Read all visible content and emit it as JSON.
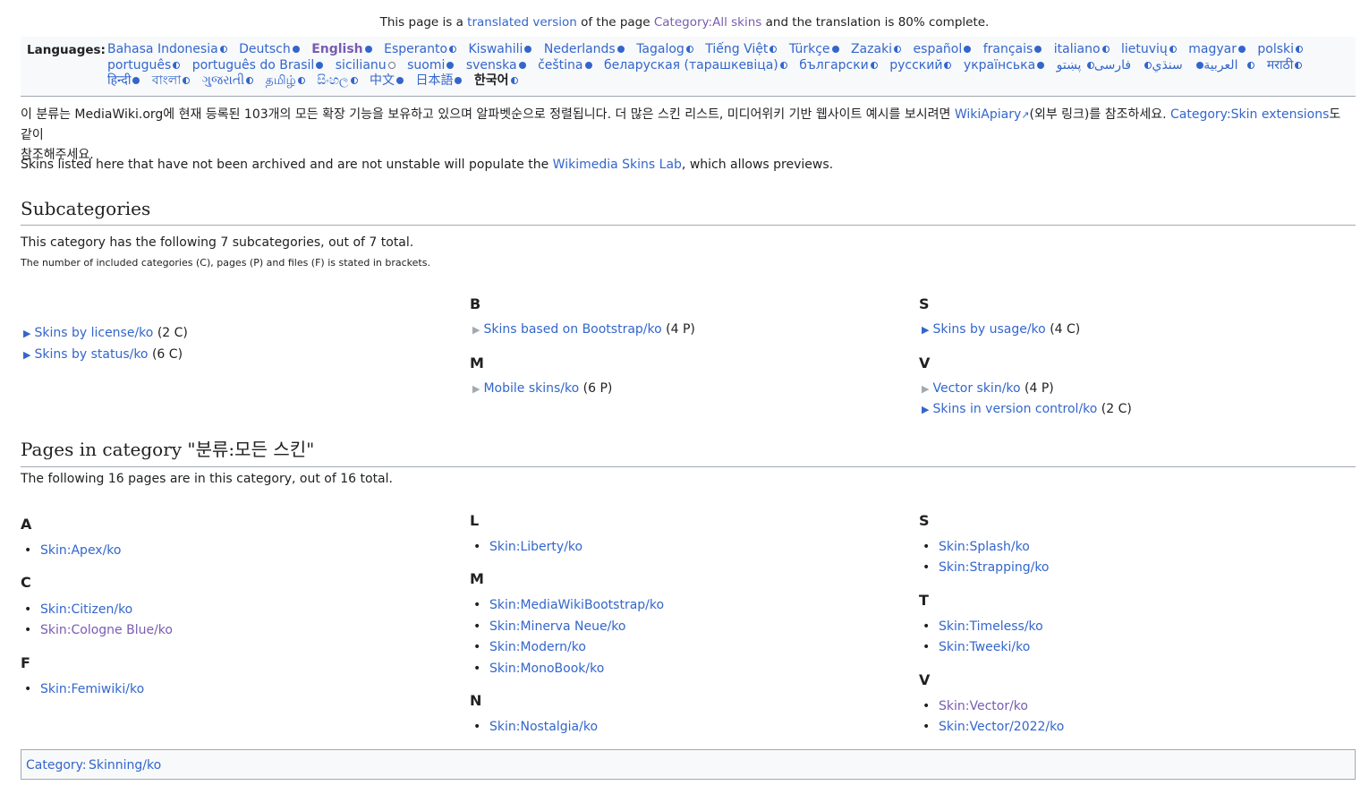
{
  "notice": {
    "prefix": "This page is a",
    "link1": "translated version",
    "middle": "of the page",
    "link2": "Category:All skins",
    "suffix": "and the translation is 80% complete."
  },
  "languages": {
    "label": "Languages:",
    "items": [
      {
        "name": "Bahasa Indonesia",
        "status": "part"
      },
      {
        "name": "Deutsch",
        "status": "full"
      },
      {
        "name": "English",
        "status": "full",
        "visited": true
      },
      {
        "name": "Esperanto",
        "status": "part"
      },
      {
        "name": "Kiswahili",
        "status": "full"
      },
      {
        "name": "Nederlands",
        "status": "full"
      },
      {
        "name": "Tagalog",
        "status": "part"
      },
      {
        "name": "Tiếng Việt",
        "status": "part"
      },
      {
        "name": "Türkçe",
        "status": "full"
      },
      {
        "name": "Zazaki",
        "status": "part"
      },
      {
        "name": "español",
        "status": "full"
      },
      {
        "name": "français",
        "status": "full"
      },
      {
        "name": "italiano",
        "status": "part"
      },
      {
        "name": "lietuvių",
        "status": "part"
      },
      {
        "name": "magyar",
        "status": "full"
      },
      {
        "name": "polski",
        "status": "part"
      },
      {
        "name": "português",
        "status": "part"
      },
      {
        "name": "português do Brasil",
        "status": "full"
      },
      {
        "name": "sicilianu",
        "status": "empty"
      },
      {
        "name": "suomi",
        "status": "full"
      },
      {
        "name": "svenska",
        "status": "full"
      },
      {
        "name": "čeština",
        "status": "full"
      },
      {
        "name": "беларуская (тарашкевіца)",
        "status": "part"
      },
      {
        "name": "български",
        "status": "part"
      },
      {
        "name": "русский",
        "status": "part"
      },
      {
        "name": "українська",
        "status": "full"
      },
      {
        "name": "العربية",
        "status": "full"
      },
      {
        "name": "سنڌي",
        "status": "part"
      },
      {
        "name": "فارسی",
        "status": "part"
      },
      {
        "name": "پښتو",
        "status": "part"
      },
      {
        "name": "मराठी",
        "status": "part"
      },
      {
        "name": "हिन्दी",
        "status": "full"
      },
      {
        "name": "বাংলা",
        "status": "part"
      },
      {
        "name": "ગુજરાતી",
        "status": "part"
      },
      {
        "name": "தமிழ்",
        "status": "part"
      },
      {
        "name": "සිංහල",
        "status": "part"
      },
      {
        "name": "中文",
        "status": "full"
      },
      {
        "name": "日本語",
        "status": "full"
      },
      {
        "name": "한국어",
        "status": "part",
        "current": true
      }
    ]
  },
  "intro": {
    "t1": "이 분류는 MediaWiki.org에 현재 등록된 103개의 모든 확장 기능을 보유하고 있으며 알파벳순으로 정렬됩니다. 더 많은 스킨 리스트, 미디어위키 기반 웹사이트 예시를 보시려면 ",
    "link1": "WikiApiary",
    "t2": "(외부 링크)를 참조하세요. ",
    "link2": "Category:Skin extensions",
    "t3": "도 같이",
    "t4": "참조해주세요.",
    "p2a": "Skins listed here that have not been archived and are not unstable will populate the ",
    "p2link": "Wikimedia Skins Lab",
    "p2b": ", which allows previews."
  },
  "subcats": {
    "heading": "Subcategories",
    "summary": "This category has the following 7 subcategories, out of 7 total.",
    "note": "The number of included categories (C), pages (P) and files (F) is stated in brackets.",
    "col1": [
      {
        "name": "Skins by license/ko",
        "count": "(2 C)"
      },
      {
        "name": "Skins by status/ko",
        "count": "(6 C)"
      }
    ],
    "col2": {
      "h_b": "B",
      "b": [
        {
          "name": "Skins based on Bootstrap/ko",
          "count": "(4 P)"
        }
      ],
      "h_m": "M",
      "m": [
        {
          "name": "Mobile skins/ko",
          "count": "(6 P)"
        }
      ]
    },
    "col3": {
      "h_s": "S",
      "s": [
        {
          "name": "Skins by usage/ko",
          "count": "(4 C)"
        }
      ],
      "h_v": "V",
      "v": [
        {
          "name": "Vector skin/ko",
          "count": "(4 P)"
        },
        {
          "name": "Skins in version control/ko",
          "count": "(2 C)"
        }
      ]
    }
  },
  "pages": {
    "heading": "Pages in category \"분류:모든 스킨\"",
    "summary": "The following 16 pages are in this category, out of 16 total.",
    "col1": {
      "h_a": "A",
      "a": [
        "Skin:Apex/ko"
      ],
      "h_c": "C",
      "c": [
        "Skin:Citizen/ko",
        "Skin:Cologne Blue/ko"
      ],
      "h_f": "F",
      "f": [
        "Skin:Femiwiki/ko"
      ]
    },
    "col2": {
      "h_l": "L",
      "l": [
        "Skin:Liberty/ko"
      ],
      "h_m": "M",
      "m": [
        "Skin:MediaWikiBootstrap/ko",
        "Skin:Minerva Neue/ko",
        "Skin:Modern/ko",
        "Skin:MonoBook/ko"
      ],
      "h_n": "N",
      "n": [
        "Skin:Nostalgia/ko"
      ]
    },
    "col3": {
      "h_s": "S",
      "s": [
        "Skin:Splash/ko",
        "Skin:Strapping/ko"
      ],
      "h_t": "T",
      "t": [
        "Skin:Timeless/ko",
        "Skin:Tweeki/ko"
      ],
      "h_v": "V",
      "v": [
        "Skin:Vector/ko",
        "Skin:Vector/2022/ko"
      ]
    }
  },
  "catlinks": {
    "label": "Category:",
    "item": "Skinning/ko"
  }
}
